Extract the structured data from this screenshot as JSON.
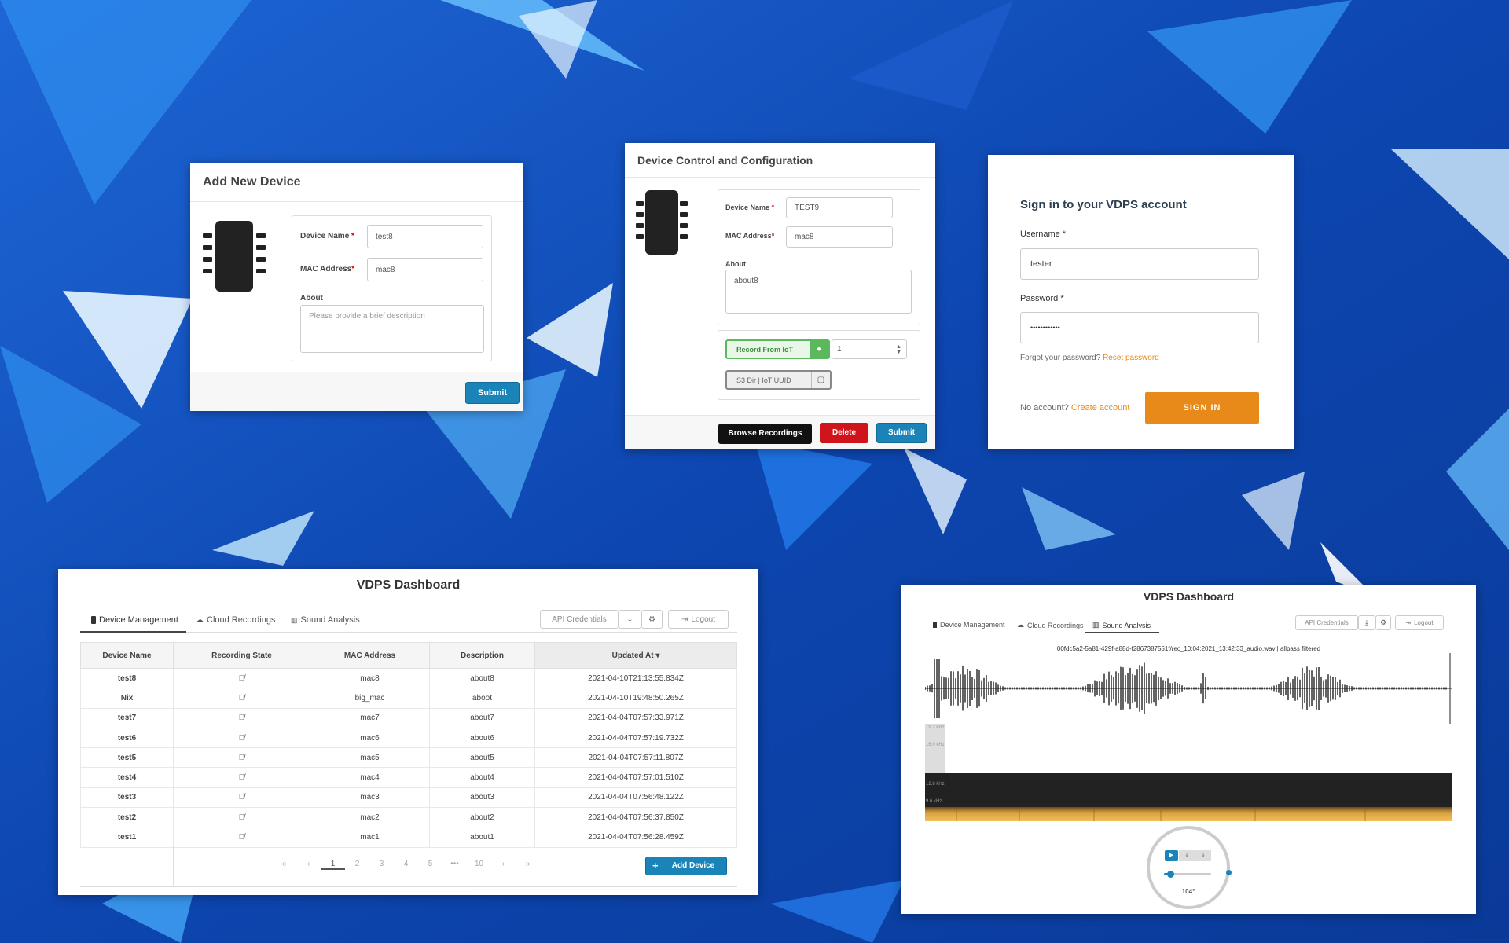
{
  "add_device": {
    "title": "Add New Device",
    "device_name_label": "Device Name",
    "device_name_value": "test8",
    "mac_label": "MAC Address",
    "mac_value": "mac8",
    "about_label": "About",
    "about_placeholder": "Please provide a brief description",
    "submit_label": "Submit",
    "required_mark": "*"
  },
  "device_control": {
    "title": "Device Control and Configuration",
    "device_name_label": "Device Name",
    "device_name_value": "TEST9",
    "mac_label": "MAC Address",
    "mac_value": "mac8",
    "about_label": "About",
    "about_value": "about8",
    "record_label": "Record From IoT",
    "duration_value": "1",
    "s3_label": "S3 Dir | IoT UUID",
    "browse_label": "Browse Recordings",
    "delete_label": "Delete",
    "submit_label": "Submit",
    "required_mark": "*"
  },
  "sign_in": {
    "title": "Sign in to your VDPS account",
    "username_label": "Username *",
    "username_value": "tester",
    "password_label": "Password *",
    "password_value": "••••••••••••",
    "forgot_text": "Forgot your password?",
    "reset_link": "Reset password",
    "no_account_text": "No account?",
    "create_link": "Create account",
    "sign_in_button": "SIGN IN"
  },
  "dashboard": {
    "title": "VDPS Dashboard",
    "tabs": [
      "Device Management",
      "Cloud Recordings",
      "Sound Analysis"
    ],
    "api_credentials": "API Credentials",
    "logout": "Logout",
    "columns": [
      "Device Name",
      "Recording State",
      "MAC Address",
      "Description",
      "Updated At"
    ],
    "sort_indicator": "▾",
    "rows": [
      {
        "name": "test8",
        "mac": "mac8",
        "desc": "about8",
        "updated": "2021-04-10T21:13:55.834Z"
      },
      {
        "name": "Nix",
        "mac": "big_mac",
        "desc": "aboot",
        "updated": "2021-04-10T19:48:50.265Z"
      },
      {
        "name": "test7",
        "mac": "mac7",
        "desc": "about7",
        "updated": "2021-04-04T07:57:33.971Z"
      },
      {
        "name": "test6",
        "mac": "mac6",
        "desc": "about6",
        "updated": "2021-04-04T07:57:19.732Z"
      },
      {
        "name": "test5",
        "mac": "mac5",
        "desc": "about5",
        "updated": "2021-04-04T07:57:11.807Z"
      },
      {
        "name": "test4",
        "mac": "mac4",
        "desc": "about4",
        "updated": "2021-04-04T07:57:01.510Z"
      },
      {
        "name": "test3",
        "mac": "mac3",
        "desc": "about3",
        "updated": "2021-04-04T07:56:48.122Z"
      },
      {
        "name": "test2",
        "mac": "mac2",
        "desc": "about2",
        "updated": "2021-04-04T07:56:37.850Z"
      },
      {
        "name": "test1",
        "mac": "mac1",
        "desc": "about1",
        "updated": "2021-04-04T07:56:28.459Z"
      }
    ],
    "pagination": [
      "«",
      "‹",
      "1",
      "2",
      "3",
      "4",
      "5",
      "•••",
      "10",
      "›",
      "»"
    ],
    "add_device_label": "Add Device"
  },
  "sound_dashboard": {
    "title": "VDPS Dashboard",
    "tabs": [
      "Device Management",
      "Cloud Recordings",
      "Sound Analysis"
    ],
    "api_credentials": "API Credentials",
    "logout": "Logout",
    "file_caption": "00fdc5a2-5a81-429f-a88d-f2867387551f/rec_10:04:2021_13:42:33_audio.wav | allpass filtered",
    "frequency_labels": [
      "19.2 kHz",
      "16.0 kHz",
      "12.8 kHz",
      "9.6 kHz"
    ],
    "knob_value": "104°",
    "volume_level": 0.12
  },
  "colors": {
    "accent_blue": "#1a83b8",
    "delete_red": "#d0141c",
    "sign_in_orange": "#e88a1a",
    "record_green": "#5cb85c"
  }
}
